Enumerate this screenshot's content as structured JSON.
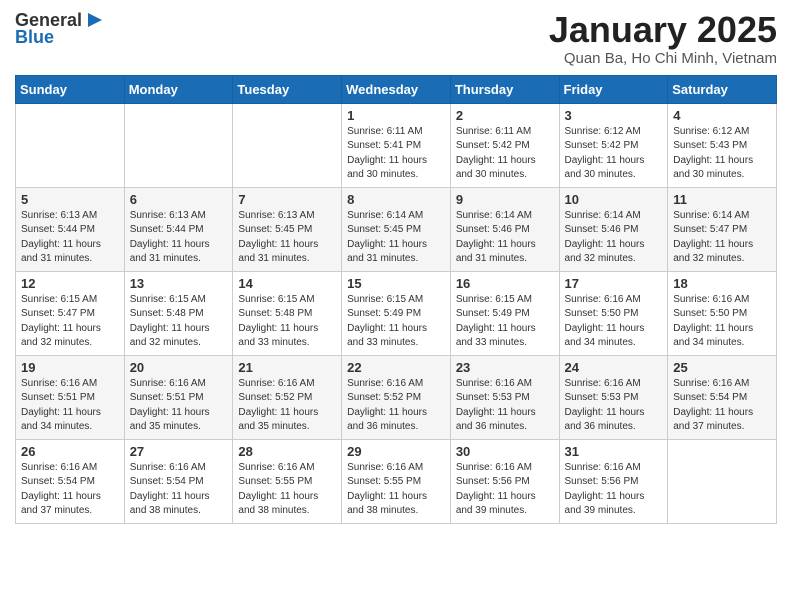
{
  "header": {
    "logo_general": "General",
    "logo_blue": "Blue",
    "month_title": "January 2025",
    "location": "Quan Ba, Ho Chi Minh, Vietnam"
  },
  "days_of_week": [
    "Sunday",
    "Monday",
    "Tuesday",
    "Wednesday",
    "Thursday",
    "Friday",
    "Saturday"
  ],
  "weeks": [
    [
      {
        "day": "",
        "info": ""
      },
      {
        "day": "",
        "info": ""
      },
      {
        "day": "",
        "info": ""
      },
      {
        "day": "1",
        "info": "Sunrise: 6:11 AM\nSunset: 5:41 PM\nDaylight: 11 hours and 30 minutes."
      },
      {
        "day": "2",
        "info": "Sunrise: 6:11 AM\nSunset: 5:42 PM\nDaylight: 11 hours and 30 minutes."
      },
      {
        "day": "3",
        "info": "Sunrise: 6:12 AM\nSunset: 5:42 PM\nDaylight: 11 hours and 30 minutes."
      },
      {
        "day": "4",
        "info": "Sunrise: 6:12 AM\nSunset: 5:43 PM\nDaylight: 11 hours and 30 minutes."
      }
    ],
    [
      {
        "day": "5",
        "info": "Sunrise: 6:13 AM\nSunset: 5:44 PM\nDaylight: 11 hours and 31 minutes."
      },
      {
        "day": "6",
        "info": "Sunrise: 6:13 AM\nSunset: 5:44 PM\nDaylight: 11 hours and 31 minutes."
      },
      {
        "day": "7",
        "info": "Sunrise: 6:13 AM\nSunset: 5:45 PM\nDaylight: 11 hours and 31 minutes."
      },
      {
        "day": "8",
        "info": "Sunrise: 6:14 AM\nSunset: 5:45 PM\nDaylight: 11 hours and 31 minutes."
      },
      {
        "day": "9",
        "info": "Sunrise: 6:14 AM\nSunset: 5:46 PM\nDaylight: 11 hours and 31 minutes."
      },
      {
        "day": "10",
        "info": "Sunrise: 6:14 AM\nSunset: 5:46 PM\nDaylight: 11 hours and 32 minutes."
      },
      {
        "day": "11",
        "info": "Sunrise: 6:14 AM\nSunset: 5:47 PM\nDaylight: 11 hours and 32 minutes."
      }
    ],
    [
      {
        "day": "12",
        "info": "Sunrise: 6:15 AM\nSunset: 5:47 PM\nDaylight: 11 hours and 32 minutes."
      },
      {
        "day": "13",
        "info": "Sunrise: 6:15 AM\nSunset: 5:48 PM\nDaylight: 11 hours and 32 minutes."
      },
      {
        "day": "14",
        "info": "Sunrise: 6:15 AM\nSunset: 5:48 PM\nDaylight: 11 hours and 33 minutes."
      },
      {
        "day": "15",
        "info": "Sunrise: 6:15 AM\nSunset: 5:49 PM\nDaylight: 11 hours and 33 minutes."
      },
      {
        "day": "16",
        "info": "Sunrise: 6:15 AM\nSunset: 5:49 PM\nDaylight: 11 hours and 33 minutes."
      },
      {
        "day": "17",
        "info": "Sunrise: 6:16 AM\nSunset: 5:50 PM\nDaylight: 11 hours and 34 minutes."
      },
      {
        "day": "18",
        "info": "Sunrise: 6:16 AM\nSunset: 5:50 PM\nDaylight: 11 hours and 34 minutes."
      }
    ],
    [
      {
        "day": "19",
        "info": "Sunrise: 6:16 AM\nSunset: 5:51 PM\nDaylight: 11 hours and 34 minutes."
      },
      {
        "day": "20",
        "info": "Sunrise: 6:16 AM\nSunset: 5:51 PM\nDaylight: 11 hours and 35 minutes."
      },
      {
        "day": "21",
        "info": "Sunrise: 6:16 AM\nSunset: 5:52 PM\nDaylight: 11 hours and 35 minutes."
      },
      {
        "day": "22",
        "info": "Sunrise: 6:16 AM\nSunset: 5:52 PM\nDaylight: 11 hours and 36 minutes."
      },
      {
        "day": "23",
        "info": "Sunrise: 6:16 AM\nSunset: 5:53 PM\nDaylight: 11 hours and 36 minutes."
      },
      {
        "day": "24",
        "info": "Sunrise: 6:16 AM\nSunset: 5:53 PM\nDaylight: 11 hours and 36 minutes."
      },
      {
        "day": "25",
        "info": "Sunrise: 6:16 AM\nSunset: 5:54 PM\nDaylight: 11 hours and 37 minutes."
      }
    ],
    [
      {
        "day": "26",
        "info": "Sunrise: 6:16 AM\nSunset: 5:54 PM\nDaylight: 11 hours and 37 minutes."
      },
      {
        "day": "27",
        "info": "Sunrise: 6:16 AM\nSunset: 5:54 PM\nDaylight: 11 hours and 38 minutes."
      },
      {
        "day": "28",
        "info": "Sunrise: 6:16 AM\nSunset: 5:55 PM\nDaylight: 11 hours and 38 minutes."
      },
      {
        "day": "29",
        "info": "Sunrise: 6:16 AM\nSunset: 5:55 PM\nDaylight: 11 hours and 38 minutes."
      },
      {
        "day": "30",
        "info": "Sunrise: 6:16 AM\nSunset: 5:56 PM\nDaylight: 11 hours and 39 minutes."
      },
      {
        "day": "31",
        "info": "Sunrise: 6:16 AM\nSunset: 5:56 PM\nDaylight: 11 hours and 39 minutes."
      },
      {
        "day": "",
        "info": ""
      }
    ]
  ]
}
